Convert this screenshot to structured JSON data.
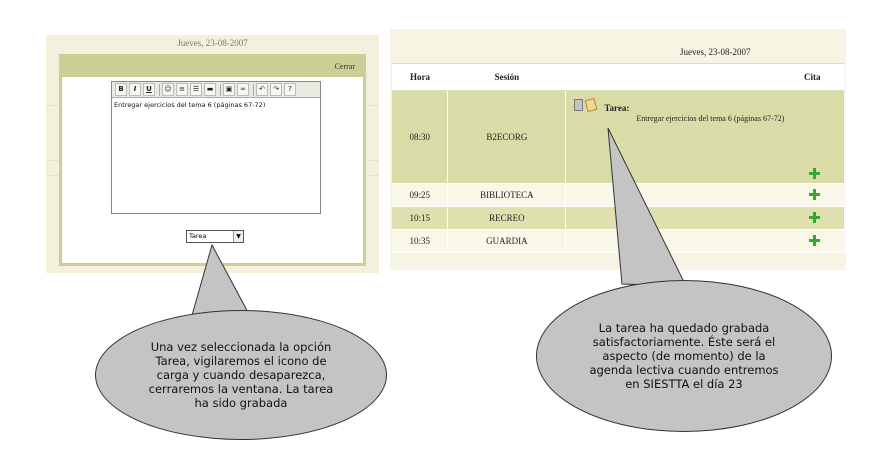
{
  "left_panel": {
    "date": "Jueves, 23-08-2007",
    "modal": {
      "close_label": "Cerrar",
      "editor_text": "Entregar ejercicios del tema 6 (páginas 67-72)",
      "toolbar": {
        "bold": "B",
        "italic": "I",
        "underline": "U"
      },
      "select": {
        "selected": "Tarea"
      }
    }
  },
  "right_panel": {
    "date": "Jueves, 23-08-2007",
    "columns": {
      "hora": "Hora",
      "sesion": "Sesión",
      "cita": "Cita"
    },
    "rows": [
      {
        "hora": "08:30",
        "sesion": "B2ECORG"
      },
      {
        "hora": "09:25",
        "sesion": "BIBLIOTECA"
      },
      {
        "hora": "10:15",
        "sesion": "RECREO"
      },
      {
        "hora": "10:35",
        "sesion": "GUARDIA"
      }
    ],
    "task": {
      "label": "Tarea:",
      "text": "Entregar ejercicios del tema 6 (páginas 67-72)"
    }
  },
  "callouts": {
    "left": "Una vez seleccionada la opción Tarea, vigilaremos el icono de carga y cuando desaparezca, cerraremos la ventana. La tarea ha sido grabada",
    "right": "La tarea ha quedado grabada satisfactoriamente. Éste será el aspecto (de momento) de la agenda lectiva cuando entremos en SIESTTA el día 23"
  },
  "colors": {
    "accent_green": "#cbcf95",
    "row_highlight": "#dfe0b0",
    "plus_icon": "#33a92e",
    "bubble_fill": "#c4c4c4"
  }
}
